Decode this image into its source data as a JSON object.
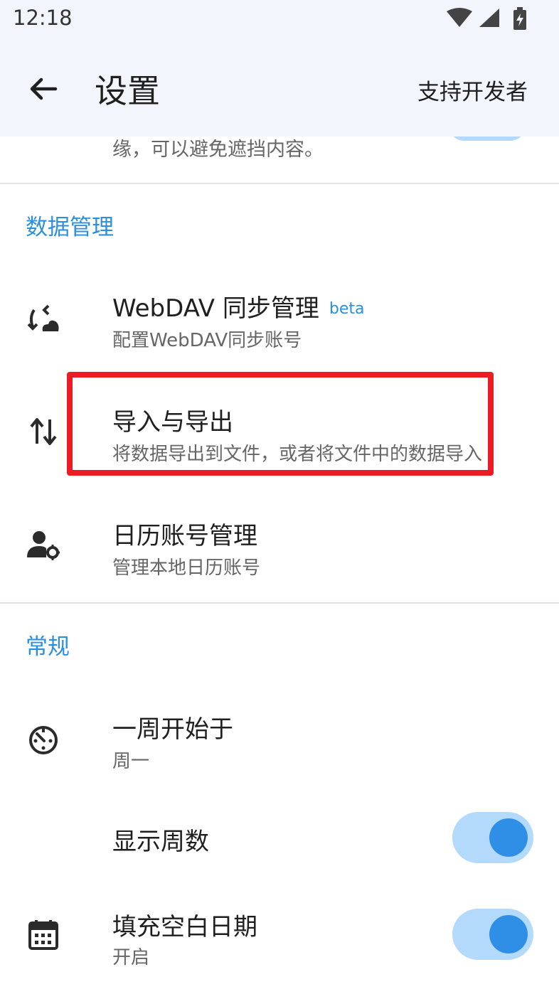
{
  "status": {
    "time": "12:18"
  },
  "appbar": {
    "title": "设置",
    "support_label": "支持开发者"
  },
  "partial_item": {
    "subtitle": "缘，可以避免遮挡内容。"
  },
  "sections": {
    "data_management": {
      "header": "数据管理",
      "webdav": {
        "title": "WebDAV 同步管理",
        "badge": "beta",
        "subtitle": "配置WebDAV同步账号"
      },
      "import_export": {
        "title": "导入与导出",
        "subtitle": "将数据导出到文件，或者将文件中的数据导入"
      },
      "calendar_accounts": {
        "title": "日历账号管理",
        "subtitle": "管理本地日历账号"
      }
    },
    "general": {
      "header": "常规",
      "week_start": {
        "title": "一周开始于",
        "subtitle": "周一"
      },
      "show_week_number": {
        "title": "显示周数",
        "enabled": true
      },
      "fill_empty_dates": {
        "title": "填充空白日期",
        "subtitle": "开启",
        "enabled": true
      }
    }
  },
  "colors": {
    "accent": "#2a8fdd",
    "toggle_track": "#b3d9fb",
    "toggle_knob": "#2f8fe7",
    "highlight": "#ec1c24"
  },
  "icons": {
    "back": "arrow-left-icon",
    "webdav": "cloud-sync-icon",
    "import_export": "swap-vertical-icon",
    "calendar_accounts": "account-cog-icon",
    "week_start": "timer-icon",
    "fill_dates": "calendar-grid-icon"
  }
}
